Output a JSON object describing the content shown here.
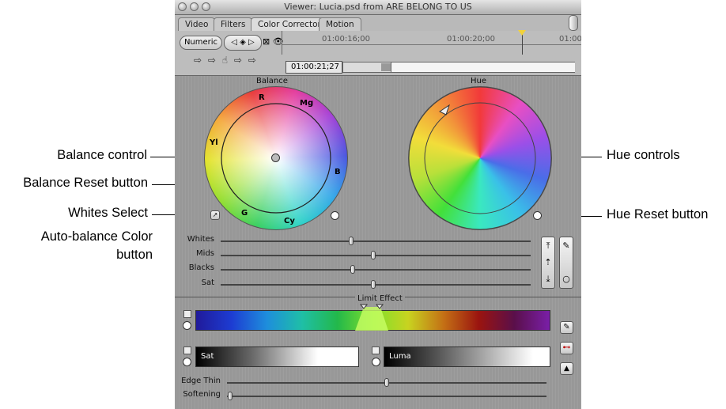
{
  "window": {
    "title": "Viewer: Lucia.psd from ARE BELONG TO US",
    "tabs": [
      "Video",
      "Filters",
      "Color Corrector",
      "Motion"
    ],
    "active_tab": "Color Corrector"
  },
  "toolbar": {
    "numeric_label": "Numeric",
    "timecodes": [
      "01:00:16;00",
      "01:00:20;00",
      "01:00"
    ],
    "current_timecode": "01:00:21;27"
  },
  "balance": {
    "header": "Balance",
    "labels": [
      "R",
      "Mg",
      "Yl",
      "B",
      "G",
      "Cy"
    ]
  },
  "hue": {
    "header": "Hue"
  },
  "sliders": [
    {
      "label": "Whites",
      "value": 0.4
    },
    {
      "label": "Mids",
      "value": 0.5
    },
    {
      "label": "Blacks",
      "value": 0.4
    },
    {
      "label": "Sat",
      "value": 0.5
    }
  ],
  "limit_effect": {
    "header": "Limit Effect",
    "sat_label": "Sat",
    "luma_label": "Luma",
    "edge_thin_label": "Edge Thin",
    "softening_label": "Softening"
  },
  "callouts": {
    "balance_control": "Balance control",
    "balance_reset": "Balance Reset button",
    "whites_select": "Whites Select",
    "auto_balance_line1": "Auto-balance Color",
    "auto_balance_line2": "button",
    "hue_controls": "Hue controls",
    "hue_reset": "Hue Reset button"
  },
  "colors": {
    "window_bg": "#9a9a9a",
    "accent_yellow": "#f2d23a"
  }
}
